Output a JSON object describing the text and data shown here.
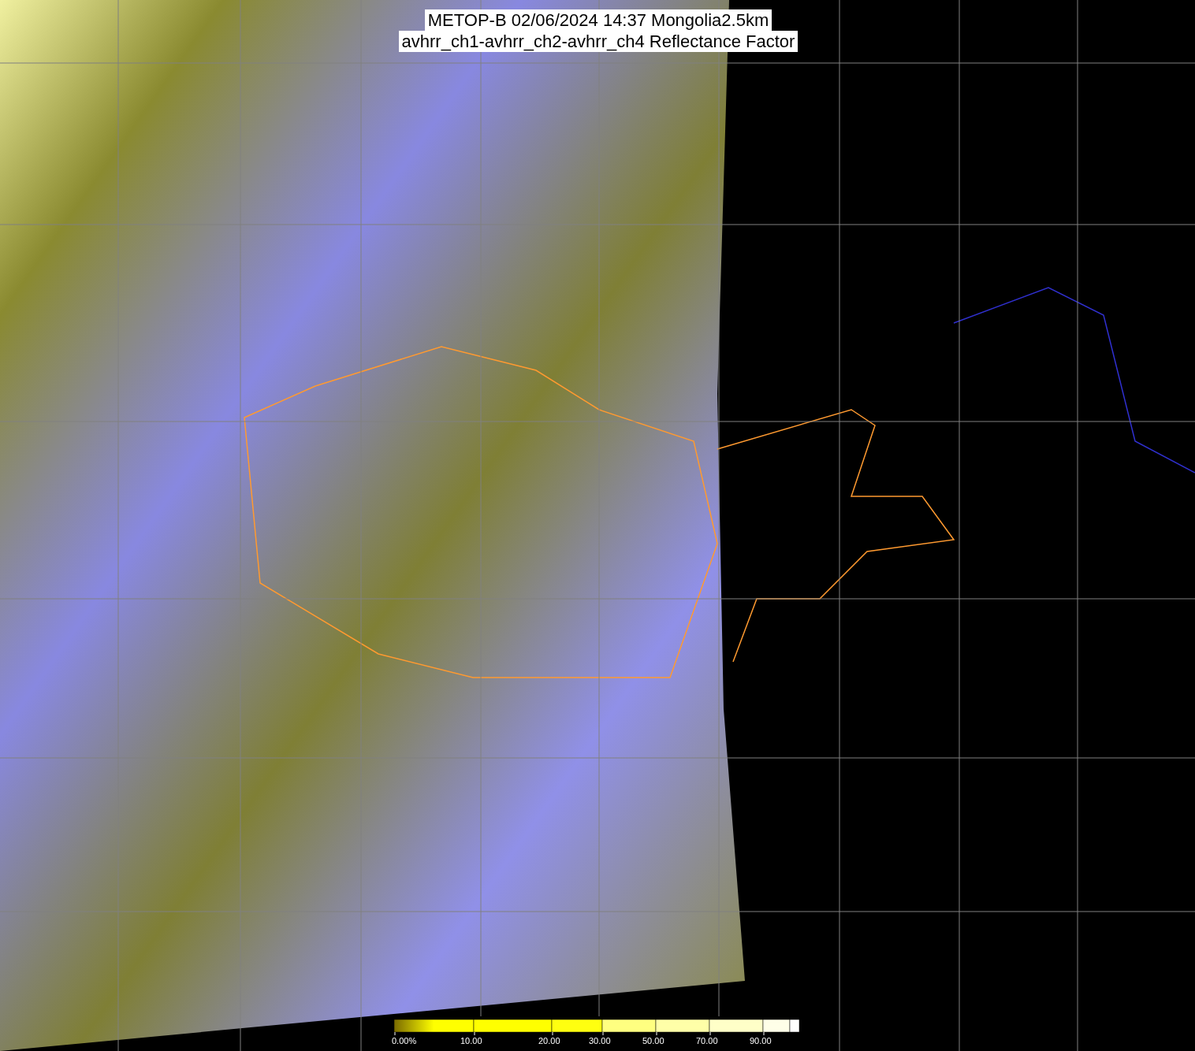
{
  "title": {
    "lines": [
      "METOP-B 02/06/2024 14:37 Mongolia2.5km",
      "avhrr_ch1-avhrr_ch2-avhrr_ch4 Reflectance Factor"
    ]
  },
  "colorbar": {
    "ticks": [
      "0.00%",
      "10.00",
      "20.00",
      "30.00",
      "50.00",
      "70.00",
      "90.00"
    ]
  }
}
